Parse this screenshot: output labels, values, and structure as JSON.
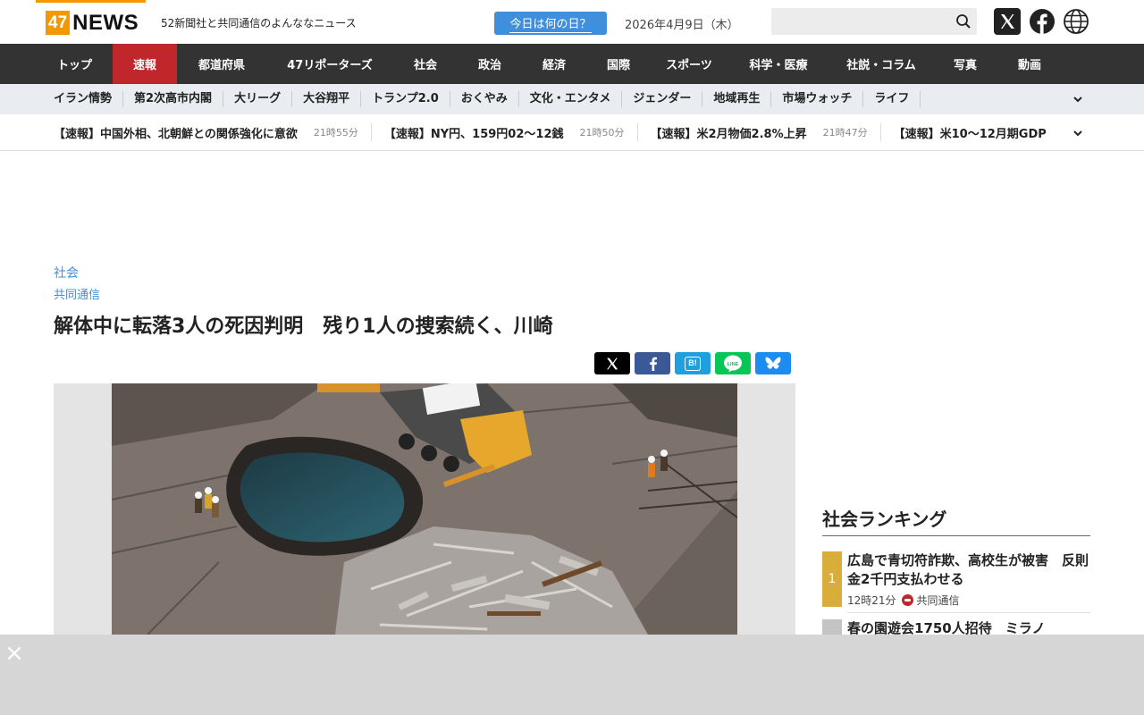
{
  "header": {
    "logo_num": "47",
    "logo_word": "NEWS",
    "tagline": "52新聞社と共同通信のよんななニュース",
    "today_button": "今日は何の日？",
    "date": "2026年4月9日（木）",
    "search_placeholder": "",
    "social_icons": [
      "x-icon",
      "facebook-icon",
      "globe-icon"
    ]
  },
  "nav": {
    "items": [
      "トップ",
      "速報",
      "都道府県",
      "47リポーターズ",
      "社会",
      "政治",
      "経済",
      "国際",
      "スポーツ",
      "科学・医療",
      "社説・コラム",
      "写真",
      "動画"
    ],
    "active": "速報"
  },
  "subnav": {
    "items": [
      "イラン情勢",
      "第2次高市内閣",
      "大リーグ",
      "大谷翔平",
      "トランプ2.0",
      "おくやみ",
      "文化・エンタメ",
      "ジェンダー",
      "地域再生",
      "市場ウォッチ",
      "ライフ"
    ]
  },
  "ticker": {
    "items": [
      {
        "title": "【速報】中国外相、北朝鮮との関係強化に意欲",
        "time": "21時55分"
      },
      {
        "title": "【速報】NY円、159円02～12銭",
        "time": "21時50分"
      },
      {
        "title": "【速報】米2月物価2.8%上昇",
        "time": "21時47分"
      },
      {
        "title": "【速報】米10～12月期GDP",
        "time": ""
      }
    ]
  },
  "article": {
    "category": "社会",
    "source": "共同通信",
    "headline": "解体中に転落3人の死因判明　残り1人の捜索続く、川崎",
    "share_buttons": [
      "x-share",
      "facebook-share",
      "hatena-share",
      "line-share",
      "bluesky-share"
    ],
    "share_labels": {
      "hatena": "B!",
      "line": "LINE"
    }
  },
  "ranking": {
    "title": "社会ランキング",
    "items": [
      {
        "rank": "1",
        "text": "広島で青切符詐欺、高校生が被害　反則金2千円支払わせる",
        "time": "12時21分",
        "source": "共同通信"
      },
      {
        "rank": "2",
        "text": "春の園遊会1750人招待　ミラノ",
        "time": "",
        "source": ""
      }
    ]
  },
  "colors": {
    "brand_orange": "#f39800",
    "nav_bg": "#333333",
    "nav_active": "#c0272d",
    "link_blue": "#3f8fdc",
    "rank_gold": "#d9ad3a",
    "rank_gray": "#c4c4c4"
  },
  "ad": {
    "close": "×"
  }
}
